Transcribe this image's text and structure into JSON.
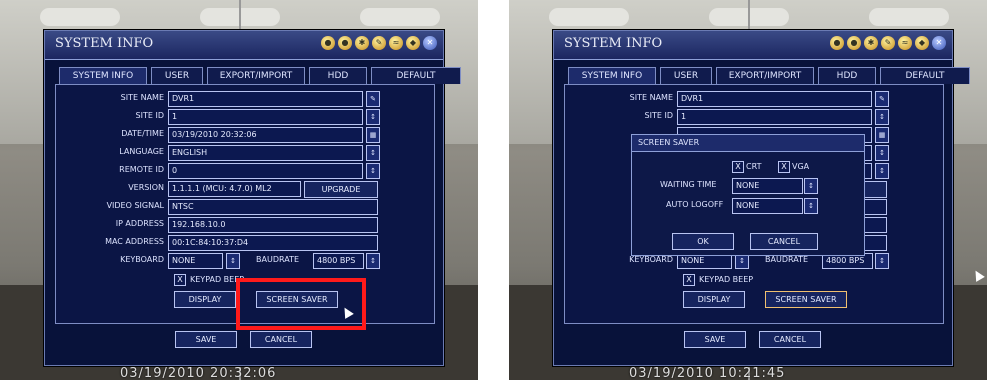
{
  "left": {
    "window_title": "SYSTEM INFO",
    "tabs": [
      "SYSTEM INFO",
      "USER",
      "EXPORT/IMPORT",
      "HDD",
      "DEFAULT"
    ],
    "fields": [
      {
        "label": "SITE NAME",
        "value": "DVR1"
      },
      {
        "label": "SITE ID",
        "value": "1"
      },
      {
        "label": "DATE/TIME",
        "value": "03/19/2010 20:32:06"
      },
      {
        "label": "LANGUAGE",
        "value": "ENGLISH"
      },
      {
        "label": "REMOTE ID",
        "value": "0"
      },
      {
        "label": "VERSION",
        "value": "1.1.1.1 (MCU: 4.7.0) ML2"
      },
      {
        "label": "VIDEO SIGNAL",
        "value": "NTSC"
      },
      {
        "label": "IP ADDRESS",
        "value": "192.168.10.0"
      },
      {
        "label": "MAC ADDRESS",
        "value": "00:1C:84:10:37:D4"
      }
    ],
    "upgrade_label": "UPGRADE",
    "keyboard_label": "KEYBOARD",
    "keyboard_value": "NONE",
    "baudrate_label": "BAUDRATE",
    "baudrate_value": "4800 BPS",
    "keypad_beep_label": "KEYPAD BEEP",
    "keypad_beep_check": "X",
    "display_label": "DISPLAY",
    "screen_saver_label": "SCREEN SAVER",
    "save_label": "SAVE",
    "cancel_label": "CANCEL",
    "timestamp": "03/19/2010 20:32:06",
    "highlight_color": "#ff1a1a"
  },
  "right": {
    "window_title": "SYSTEM INFO",
    "tabs": [
      "SYSTEM INFO",
      "USER",
      "EXPORT/IMPORT",
      "HDD",
      "DEFAULT"
    ],
    "fields": [
      {
        "label": "SITE NAME",
        "value": "DVR1"
      },
      {
        "label": "SITE ID",
        "value": "1"
      }
    ],
    "keyboard_label": "KEYBOARD",
    "keyboard_value": "NONE",
    "baudrate_label": "BAUDRATE",
    "baudrate_value": "4800 BPS",
    "keypad_beep_label": "KEYPAD BEEP",
    "keypad_beep_check": "X",
    "display_label": "DISPLAY",
    "screen_saver_label": "SCREEN SAVER",
    "save_label": "SAVE",
    "cancel_label": "CANCEL",
    "timestamp": "03/19/2010 10:21:45",
    "dialog": {
      "title": "SCREEN SAVER",
      "crt_label": "CRT",
      "crt_check": "X",
      "vga_label": "VGA",
      "vga_check": "X",
      "waiting_time_label": "WAITING TIME",
      "waiting_time_value": "NONE",
      "auto_logoff_label": "AUTO LOGOFF",
      "auto_logoff_value": "NONE",
      "ok_label": "OK",
      "cancel_label": "CANCEL"
    }
  }
}
